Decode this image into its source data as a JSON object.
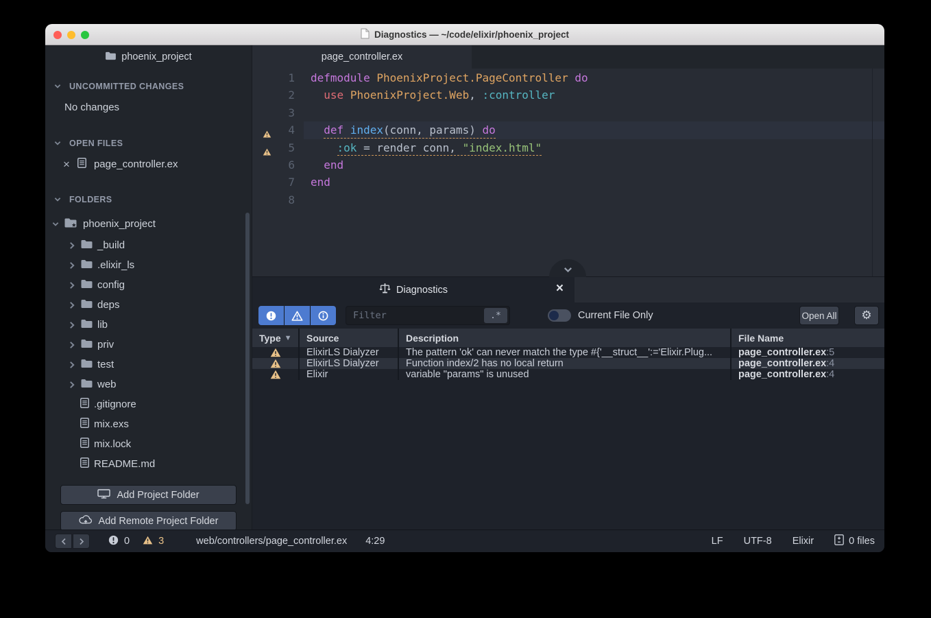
{
  "colors": {
    "accent": "#4d7bd0",
    "warning": "#e7c088",
    "kw": "#c678dd",
    "mod": "#e0a562",
    "red": "#e06c75",
    "atom": "#56b6c2",
    "fn": "#61afef",
    "str": "#98c379",
    "plain": "#b9c0cc"
  },
  "titlebar": {
    "title": "Diagnostics — ~/code/elixir/phoenix_project"
  },
  "sidebar": {
    "project_tab": "phoenix_project",
    "uncommitted": {
      "header": "UNCOMMITTED CHANGES",
      "empty": "No changes"
    },
    "open_files": {
      "header": "OPEN FILES",
      "files": [
        "page_controller.ex"
      ]
    },
    "folders_header": "FOLDERS",
    "tree": {
      "root": "phoenix_project",
      "children": [
        {
          "name": "_build",
          "type": "folder"
        },
        {
          "name": ".elixir_ls",
          "type": "folder"
        },
        {
          "name": "config",
          "type": "folder"
        },
        {
          "name": "deps",
          "type": "folder"
        },
        {
          "name": "lib",
          "type": "folder"
        },
        {
          "name": "priv",
          "type": "folder"
        },
        {
          "name": "test",
          "type": "folder"
        },
        {
          "name": "web",
          "type": "folder"
        },
        {
          "name": ".gitignore",
          "type": "file"
        },
        {
          "name": "mix.exs",
          "type": "file"
        },
        {
          "name": "mix.lock",
          "type": "file"
        },
        {
          "name": "README.md",
          "type": "file"
        }
      ]
    },
    "add_project_folder": "Add Project Folder",
    "add_remote_project_folder": "Add Remote Project Folder"
  },
  "editor": {
    "tab": "page_controller.ex",
    "lines": [
      {
        "num": 1,
        "indent": "",
        "tokens": [
          [
            "k",
            "defmodule"
          ],
          [
            "p",
            " "
          ],
          [
            "m",
            "PhoenixProject.PageController"
          ],
          [
            "p",
            " "
          ],
          [
            "k",
            "do"
          ]
        ]
      },
      {
        "num": 2,
        "indent": "  ",
        "tokens": [
          [
            "r",
            "use"
          ],
          [
            "p",
            " "
          ],
          [
            "m",
            "PhoenixProject.Web"
          ],
          [
            "p",
            ", "
          ],
          [
            "a",
            ":controller"
          ]
        ]
      },
      {
        "num": 3,
        "indent": "",
        "tokens": []
      },
      {
        "num": 4,
        "indent": "  ",
        "warn": true,
        "highlight": true,
        "underline": true,
        "tokens": [
          [
            "k",
            "def"
          ],
          [
            "p",
            " "
          ],
          [
            "f",
            "index"
          ],
          [
            "p",
            "(conn, params)"
          ],
          [
            "p",
            " "
          ],
          [
            "k",
            "do"
          ]
        ]
      },
      {
        "num": 5,
        "indent": "    ",
        "warn": true,
        "underline": true,
        "tokens": [
          [
            "a",
            ":ok"
          ],
          [
            "p",
            " = render conn, "
          ],
          [
            "s",
            "\"index.html\""
          ]
        ]
      },
      {
        "num": 6,
        "indent": "  ",
        "tokens": [
          [
            "k",
            "end"
          ]
        ]
      },
      {
        "num": 7,
        "indent": "",
        "tokens": [
          [
            "k",
            "end"
          ]
        ]
      },
      {
        "num": 8,
        "indent": "",
        "tokens": []
      }
    ]
  },
  "diagnostics": {
    "tab": "Diagnostics",
    "filter_placeholder": "Filter",
    "regex_button": ".*",
    "current_file_only": "Current File Only",
    "open_all": "Open All",
    "headers": [
      "Type",
      "Source",
      "Description",
      "File Name"
    ],
    "rows": [
      {
        "severity": "warning",
        "source": "ElixirLS Dialyzer",
        "description": "The pattern 'ok' can never match the type #{'__struct__':='Elixir.Plug...",
        "file": "page_controller.ex",
        "line": "5"
      },
      {
        "severity": "warning",
        "source": "ElixirLS Dialyzer",
        "description": "Function index/2 has no local return",
        "file": "page_controller.ex",
        "line": "4"
      },
      {
        "severity": "warning",
        "source": "Elixir",
        "description": "variable \"params\" is unused",
        "file": "page_controller.ex",
        "line": "4"
      }
    ]
  },
  "statusbar": {
    "errors": "0",
    "warnings": "3",
    "path": "web/controllers/page_controller.ex",
    "cursor": "4:29",
    "line_ending": "LF",
    "encoding": "UTF-8",
    "grammar": "Elixir",
    "git_status": "0 files"
  }
}
